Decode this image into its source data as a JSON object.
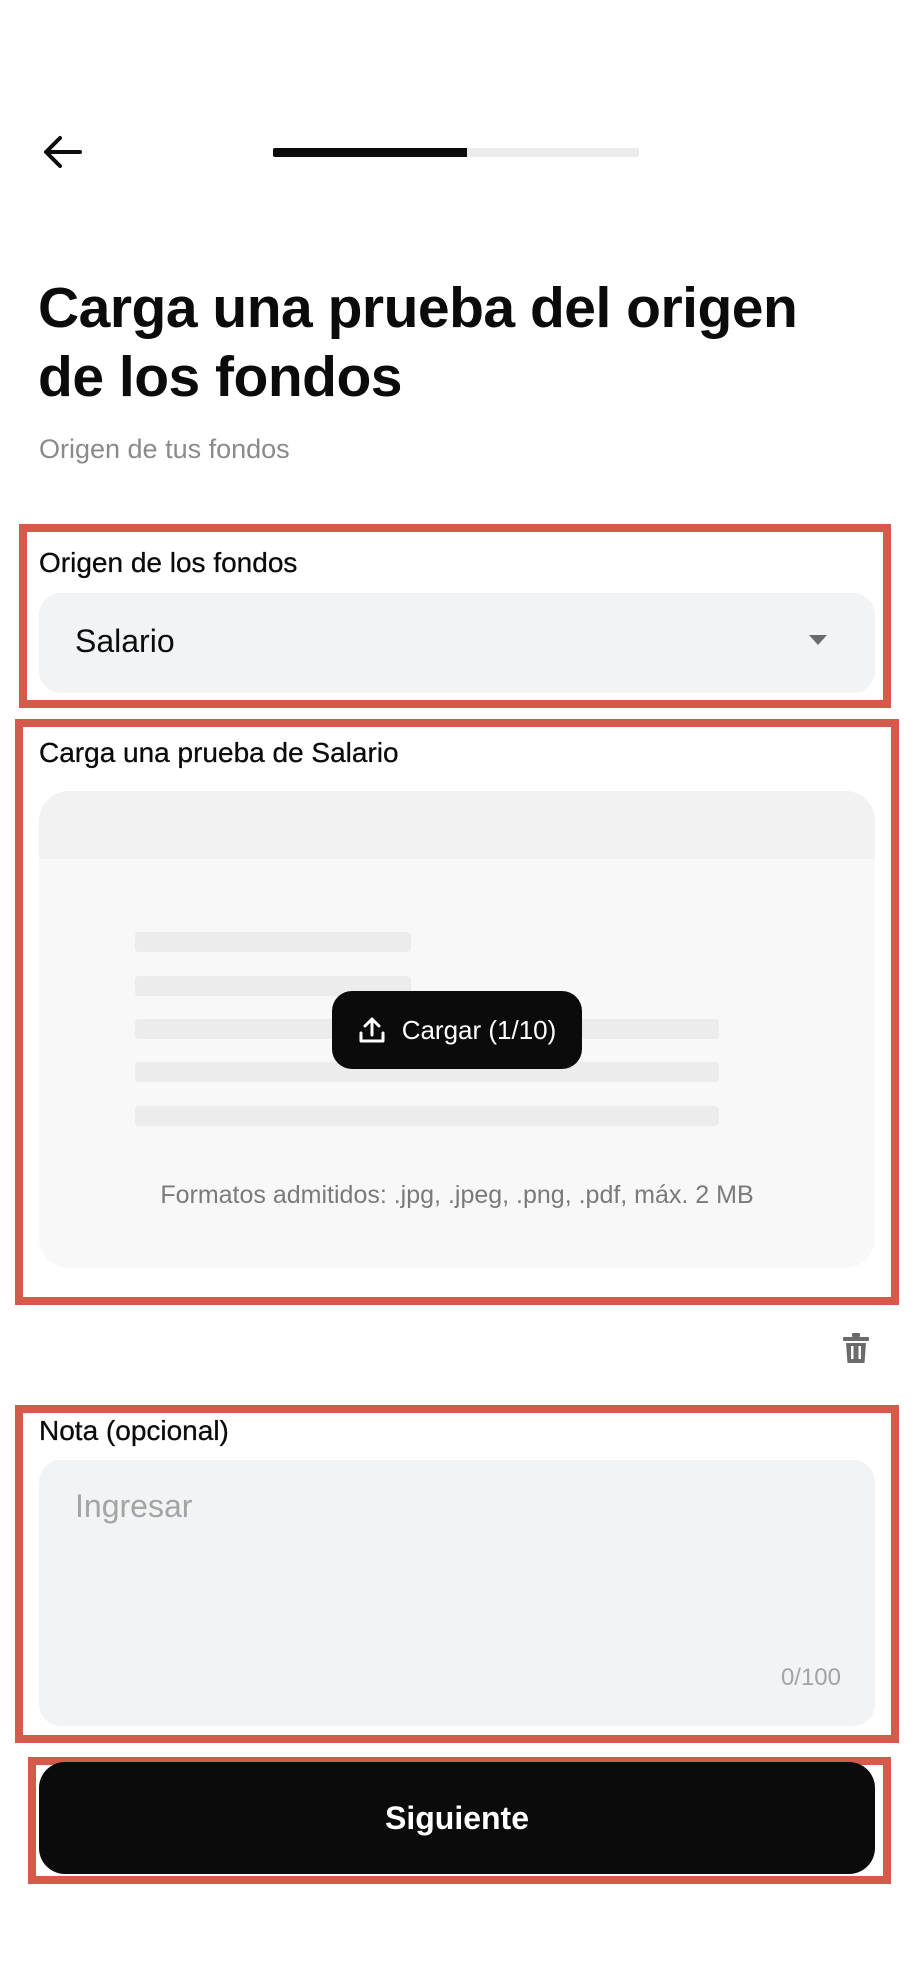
{
  "header": {
    "back_icon": "arrow-left-icon",
    "progress_fraction": 0.53
  },
  "page": {
    "title": "Carga una prueba del origen de los fondos",
    "subtitle": "Origen de tus fondos"
  },
  "funds_origin": {
    "label": "Origen de los fondos",
    "selected": "Salario",
    "dropdown_icon": "caret-down-icon"
  },
  "upload": {
    "label": "Carga una prueba de Salario",
    "button_label": "Cargar (1/10)",
    "button_icon": "upload-icon",
    "formats_note": "Formatos admitidos: .jpg, .jpeg, .png, .pdf, máx. 2 MB",
    "delete_icon": "trash-icon"
  },
  "note": {
    "label": "Nota (opcional)",
    "placeholder": "Ingresar",
    "value": "",
    "counter": "0/100"
  },
  "footer": {
    "next_label": "Siguiente"
  },
  "colors": {
    "primary": "#0b0b0b",
    "field_bg": "#f1f3f4",
    "annotation": "#d65a4a",
    "muted_text": "#8a8a8a"
  }
}
